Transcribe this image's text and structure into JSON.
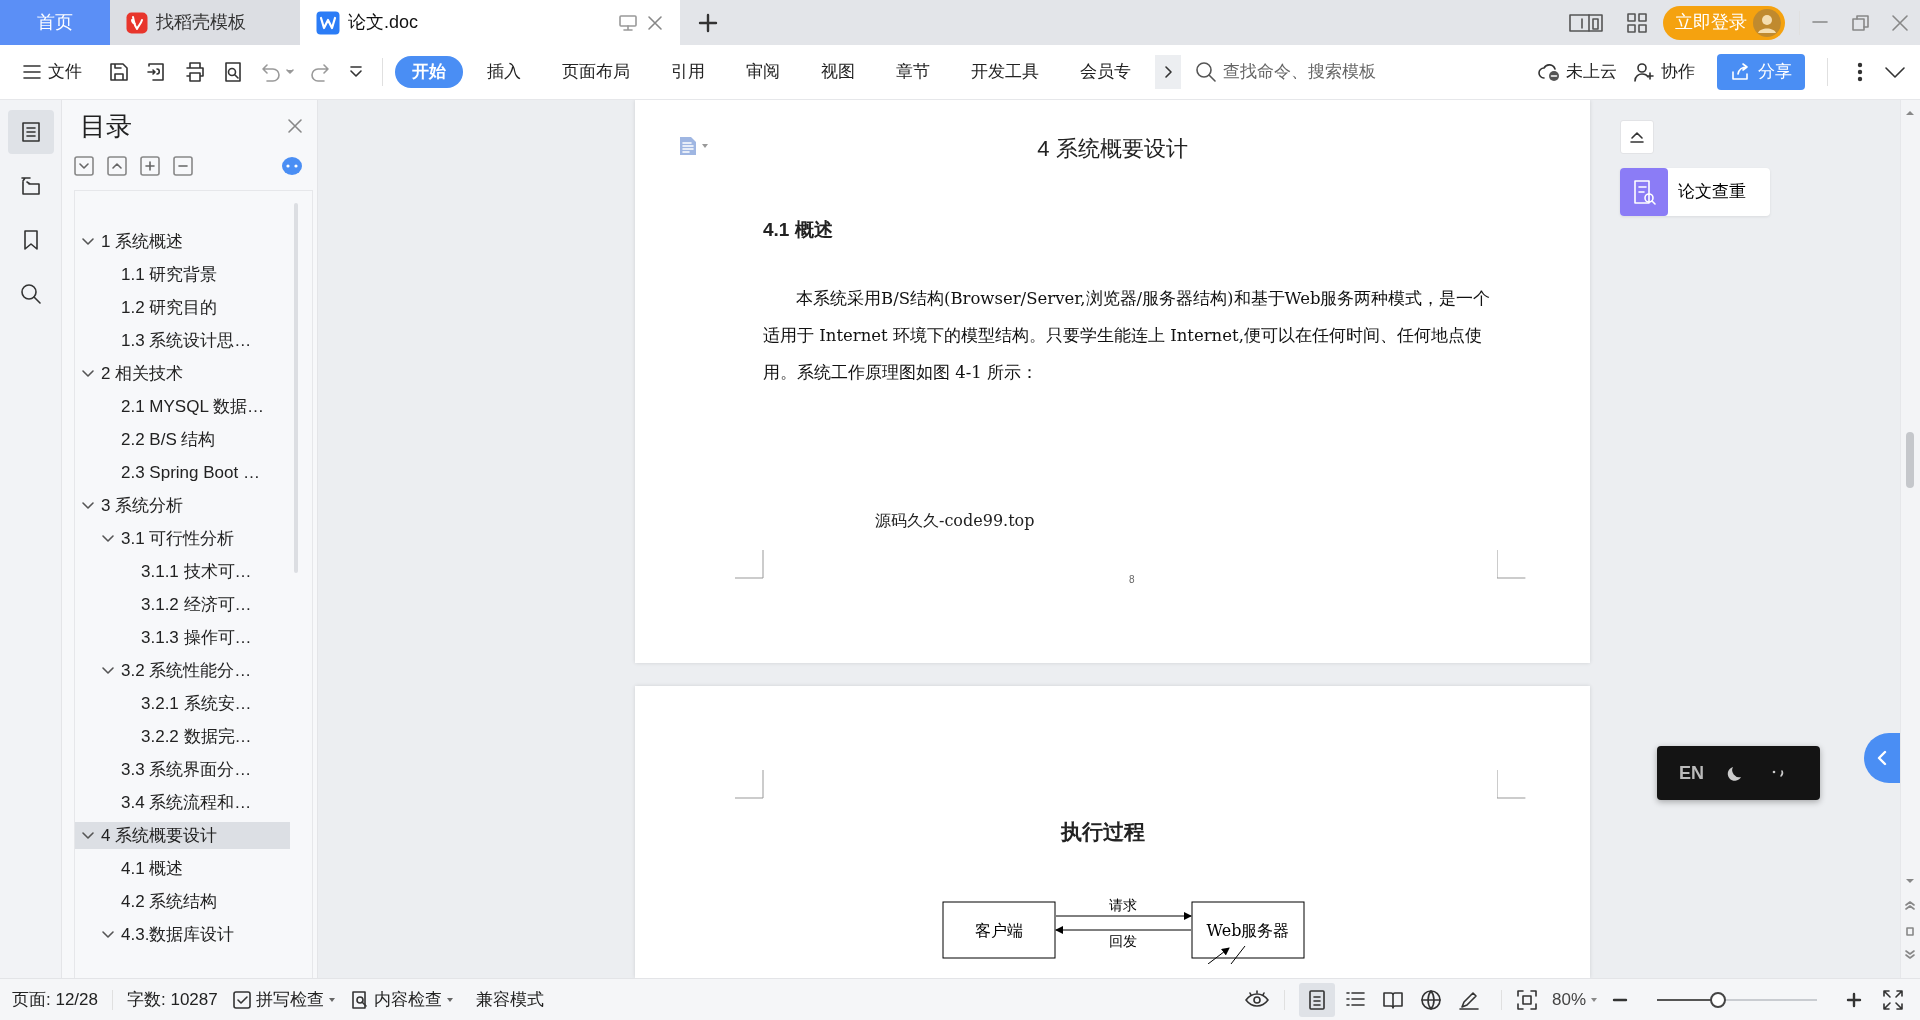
{
  "tabs": [
    {
      "label": "首页",
      "kind": "home",
      "selected": false
    },
    {
      "label": "找稻壳模板",
      "kind": "docer",
      "selected": false
    },
    {
      "label": "论文.doc",
      "kind": "document",
      "selected": true
    }
  ],
  "login_button": "立即登录",
  "toolbar": {
    "file_menu": "文件",
    "ribbon_tabs": [
      {
        "label": "开始",
        "selected": true
      },
      {
        "label": "插入",
        "selected": false
      },
      {
        "label": "页面布局",
        "selected": false
      },
      {
        "label": "引用",
        "selected": false
      },
      {
        "label": "审阅",
        "selected": false
      },
      {
        "label": "视图",
        "selected": false
      },
      {
        "label": "章节",
        "selected": false
      },
      {
        "label": "开发工具",
        "selected": false
      },
      {
        "label": "会员专",
        "selected": false
      }
    ],
    "search": {
      "placeholder": "查找命令、搜索模板"
    },
    "cloud_status": "未上云",
    "collaborate": "协作",
    "share": "分享"
  },
  "sidebar_tools": [
    {
      "kind": "outline",
      "selected": true
    },
    {
      "kind": "navigation",
      "selected": false
    },
    {
      "kind": "bookmark",
      "selected": false
    },
    {
      "kind": "search",
      "selected": false
    }
  ],
  "toc": {
    "title": "目录",
    "items": [
      {
        "label": "1 系统概述",
        "selected": false,
        "expanded": true,
        "children": [
          {
            "label": "1.1  研究背景",
            "selected": false
          },
          {
            "label": "1.2 研究目的",
            "selected": false
          },
          {
            "label": "1.3 系统设计思…",
            "selected": false
          }
        ]
      },
      {
        "label": "2 相关技术",
        "selected": false,
        "expanded": true,
        "children": [
          {
            "label": "2.1 MYSQL 数据…",
            "selected": false
          },
          {
            "label": "2.2 B/S 结构",
            "selected": false
          },
          {
            "label": "2.3 Spring Boot …",
            "selected": false
          }
        ]
      },
      {
        "label": "3 系统分析",
        "selected": false,
        "expanded": true,
        "children": [
          {
            "label": "3.1 可行性分析",
            "selected": false,
            "expanded": true,
            "children": [
              {
                "label": "3.1.1 技术可…",
                "selected": false
              },
              {
                "label": "3.1.2 经济可…",
                "selected": false
              },
              {
                "label": "3.1.3 操作可…",
                "selected": false
              }
            ]
          },
          {
            "label": "3.2 系统性能分…",
            "selected": false,
            "expanded": true,
            "children": [
              {
                "label": "3.2.1  系统安…",
                "selected": false
              },
              {
                "label": "3.2.2  数据完…",
                "selected": false
              }
            ]
          },
          {
            "label": "3.3 系统界面分…",
            "selected": false
          },
          {
            "label": "3.4 系统流程和…",
            "selected": false
          }
        ]
      },
      {
        "label": "4 系统概要设计",
        "selected": true,
        "expanded": true,
        "children": [
          {
            "label": "4.1 概述",
            "selected": false
          },
          {
            "label": "4.2 系统结构",
            "selected": false
          },
          {
            "label": "4.3.数据库设计",
            "selected": false,
            "expanded": true
          }
        ]
      }
    ]
  },
  "document": {
    "pages": [
      {
        "blocks": [
          {
            "kind": "chapter_title",
            "text": "4 系统概要设计"
          },
          {
            "kind": "section_title",
            "text": "4.1 概述"
          },
          {
            "kind": "paragraph",
            "text": "本系统采用B/S结构(Browser/Server,浏览器/服务器结构)和基于Web服务两种模式，是一个适用于 Internet 环境下的模型结构。只要学生能连上 Internet,便可以在任何时间、任何地点使用。系统工作原理图如图 4-1 所示："
          },
          {
            "kind": "caption",
            "text": "源码久久-code99.top"
          }
        ],
        "page_number": "8"
      },
      {
        "blocks": [
          {
            "kind": "diagram_title",
            "text": "执行过程"
          },
          {
            "kind": "diagram",
            "nodes": [
              "客户端",
              "Web服务器"
            ],
            "edges": [
              {
                "label": "请求",
                "reverse": false
              },
              {
                "label": "回发",
                "reverse": true
              }
            ]
          }
        ]
      }
    ]
  },
  "side_panel": {
    "plagiarism_check": "论文查重"
  },
  "ime_bar": {
    "language": "EN"
  },
  "status_bar": {
    "page": "页面: 12/28",
    "word_count": "字数: 10287",
    "spell_check": "拼写检查",
    "content_check": "内容检查",
    "compat_mode": "兼容模式",
    "view_modes": [
      {
        "kind": "page",
        "selected": true
      },
      {
        "kind": "outline",
        "selected": false
      },
      {
        "kind": "reading",
        "selected": false
      },
      {
        "kind": "web",
        "selected": false
      },
      {
        "kind": "write",
        "selected": false
      }
    ],
    "zoom": "80%",
    "zoom_slider": {
      "level": 0.38
    }
  }
}
